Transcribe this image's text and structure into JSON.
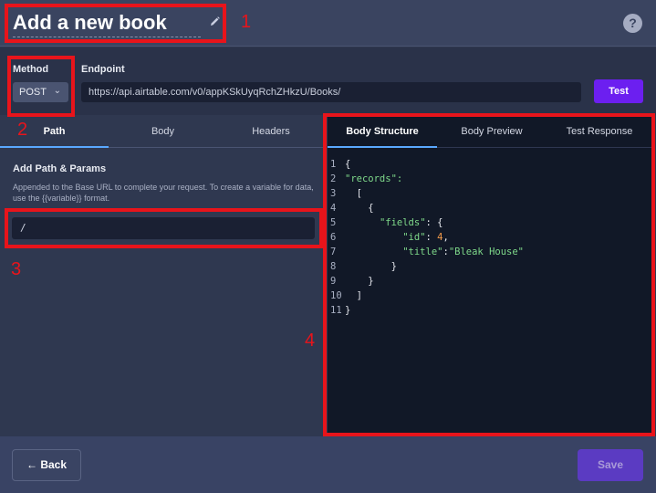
{
  "header": {
    "title": "Add a new book",
    "edit_icon": "pencil-icon",
    "help_icon": "question-circle-icon",
    "help_label": "?"
  },
  "request": {
    "method_label": "Method",
    "method_value": "POST",
    "endpoint_label": "Endpoint",
    "endpoint_value": "https://api.airtable.com/v0/appKSkUyqRchZHkzU/Books/",
    "test_label": "Test"
  },
  "left_tabs": [
    {
      "label": "Path",
      "active": true
    },
    {
      "label": "Body",
      "active": false
    },
    {
      "label": "Headers",
      "active": false
    }
  ],
  "path_section": {
    "heading": "Add Path & Params",
    "help_text": "Appended to the Base URL to complete your request. To create a variable for data, use the {{variable}} format.",
    "path_value": "/"
  },
  "right_tabs": [
    {
      "label": "Body Structure",
      "active": true
    },
    {
      "label": "Body Preview",
      "active": false
    },
    {
      "label": "Test Response",
      "active": false
    }
  ],
  "code_lines": [
    {
      "num": "1",
      "text": "{"
    },
    {
      "num": "2",
      "text": "\"records\":"
    },
    {
      "num": "3",
      "text": "  ["
    },
    {
      "num": "4",
      "text": "    {"
    },
    {
      "num": "5",
      "text": "      \"fields\": {"
    },
    {
      "num": "6",
      "text": "          \"id\": 4,"
    },
    {
      "num": "7",
      "text": "          \"title\":\"Bleak House\""
    },
    {
      "num": "8",
      "text": "        }"
    },
    {
      "num": "9",
      "text": "    }"
    },
    {
      "num": "10",
      "text": "  ]"
    },
    {
      "num": "11",
      "text": "}"
    }
  ],
  "footer": {
    "back_label": "← Back",
    "save_label": "Save"
  },
  "annotations": [
    "1",
    "2",
    "3",
    "4"
  ],
  "colors": {
    "accent": "#6c1ff0",
    "annotation_red": "#e8141b",
    "json_string": "#7fd98a",
    "json_number": "#f29a4a"
  }
}
